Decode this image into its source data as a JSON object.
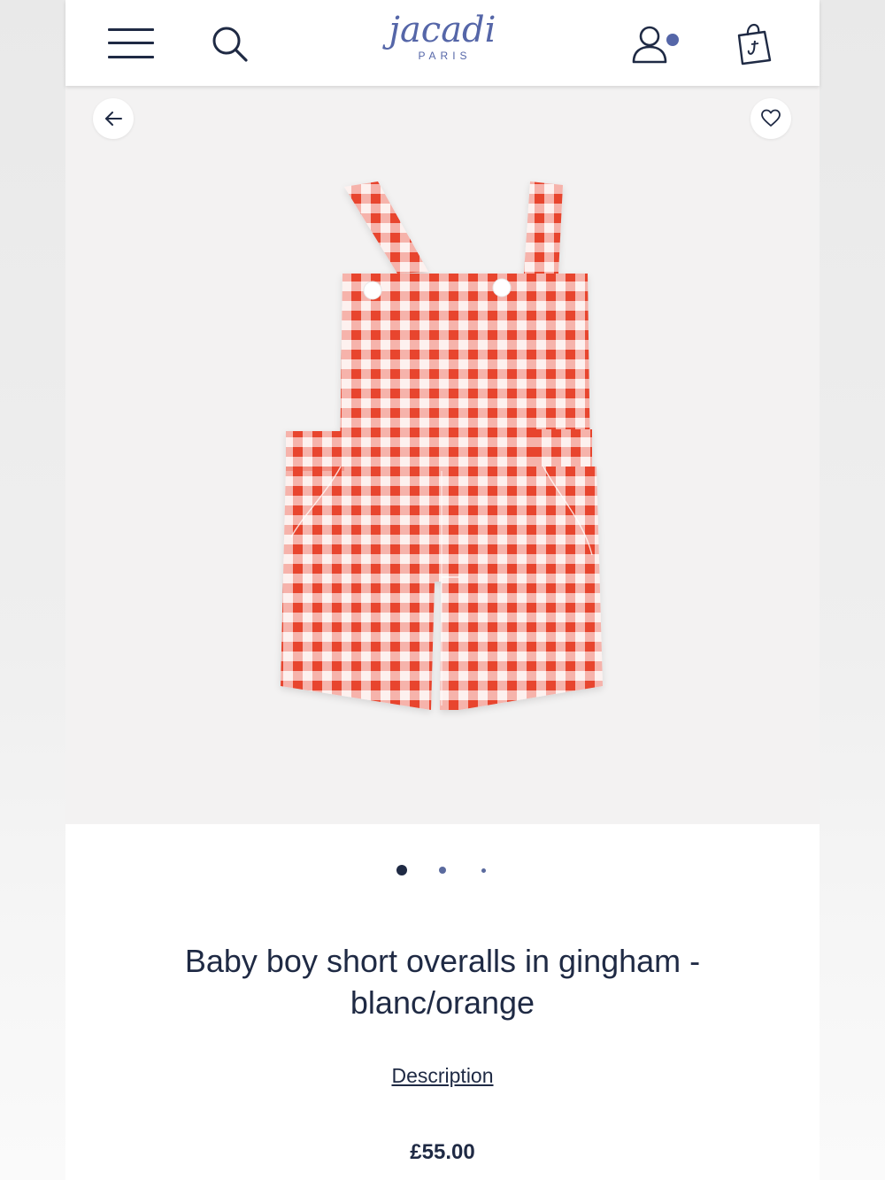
{
  "header": {
    "brand_name": "Jacadi",
    "brand_sub": "PARIS",
    "icons": [
      "menu-icon",
      "search-icon",
      "account-icon",
      "shopping-bag-icon"
    ]
  },
  "gallery": {
    "icons": [
      "back-arrow-icon",
      "heart-icon"
    ],
    "image_alt": "Baby boy short overalls in gingham - blanc/orange",
    "slide_count": 3,
    "active_slide": 1
  },
  "product": {
    "title": "Baby boy short overalls in gingham - blanc/orange",
    "description_link": "Description",
    "price": "£55.00"
  },
  "colors": {
    "brand": "#5566a8",
    "text": "#1f2a44",
    "gingham_red": "#e8442f",
    "gingham_pink": "#f6b3ab"
  }
}
